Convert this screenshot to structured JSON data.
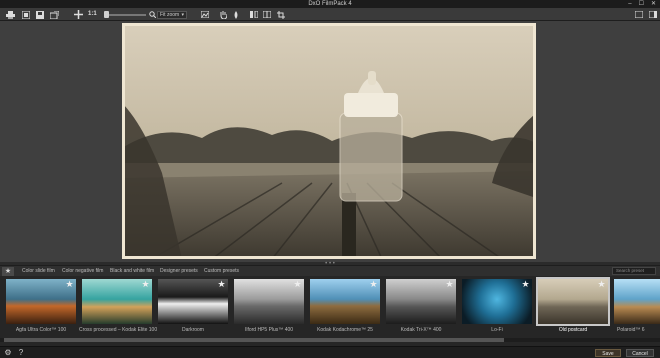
{
  "window": {
    "title": "DxO FilmPack 4",
    "controls": [
      "–",
      "☐",
      "✕"
    ]
  },
  "toolbar": {
    "zoom_ratio": "1:1",
    "zoom_mode": "Fit zoom",
    "icons": [
      "print-icon",
      "open-icon",
      "save-icon",
      "export-icon",
      "move-icon",
      "hand-icon",
      "dropper-icon",
      "compare-icon",
      "split-view-icon",
      "crop-icon"
    ]
  },
  "preview": {
    "description_icon": "photo"
  },
  "tabs": {
    "favorites_icon": "★",
    "items": [
      "Color slide film",
      "Color negative film",
      "Black and white film",
      "Designer presets",
      "Custom presets"
    ],
    "search_placeholder": "Search preset"
  },
  "presets": [
    {
      "label": "Agfa Ultra Color™ 100"
    },
    {
      "label": "Cross processed – Kodak Elite 100"
    },
    {
      "label": "Darkroom"
    },
    {
      "label": "Ilford HP5 Plus™ 400"
    },
    {
      "label": "Kodak Kodachrome™ 25"
    },
    {
      "label": "Kodak Tri-X™ 400"
    },
    {
      "label": "Lo-Fi"
    },
    {
      "label": "Old postcard",
      "selected": true
    },
    {
      "label": "Polaroid™ 6"
    }
  ],
  "bottom": {
    "settings_icon": "⚙",
    "help_icon": "?",
    "save_label": "Save",
    "cancel_label": "Cancel"
  },
  "colors": {
    "selected_outline": "#c8c8c8",
    "background": "#3f3f3f"
  }
}
